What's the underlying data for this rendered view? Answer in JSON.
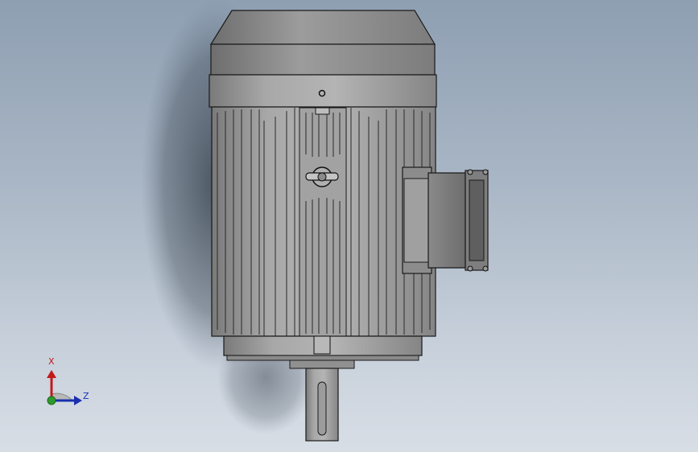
{
  "viewport": {
    "background_top": "#8e9fb2",
    "background_bottom": "#d8dee6"
  },
  "model": {
    "object": "electric motor",
    "view": "top",
    "body_color": "#9a9a9a",
    "edge_color": "#1a1a1a"
  },
  "triad": {
    "x_label": "X",
    "z_label": "Z",
    "x_color": "#c21a1a",
    "y_color": "#2e9a2e",
    "z_color": "#1a2fb0"
  }
}
